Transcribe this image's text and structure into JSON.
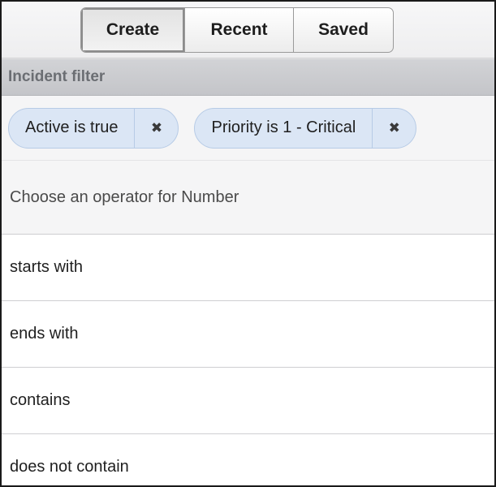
{
  "tabs": [
    {
      "label": "Create",
      "active": true
    },
    {
      "label": "Recent",
      "active": false
    },
    {
      "label": "Saved",
      "active": false
    }
  ],
  "filter": {
    "title": "Incident filter",
    "chips": [
      {
        "label": "Active is true",
        "remove_icon": "close-icon"
      },
      {
        "label": "Priority is 1 - Critical",
        "remove_icon": "close-icon"
      }
    ]
  },
  "operators": {
    "title": "Choose an operator for Number",
    "items": [
      "starts with",
      "ends with",
      "contains",
      "does not contain"
    ]
  },
  "colors": {
    "chip_background": "#dbe6f5",
    "chip_border": "#b7cbe6",
    "header_text": "#6b6e73"
  }
}
